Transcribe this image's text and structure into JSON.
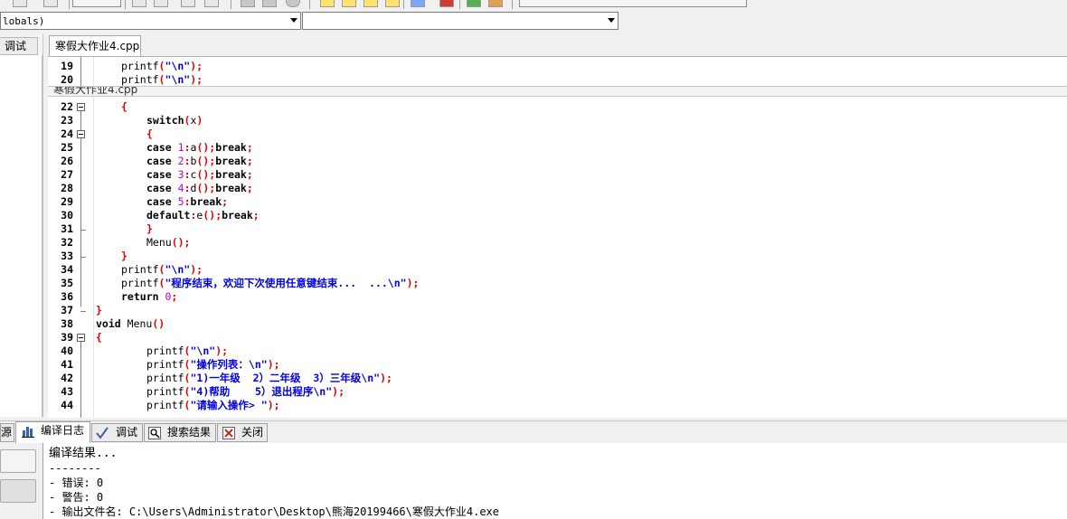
{
  "toolbar": {
    "scope_combo": "lobals)",
    "member_combo": ""
  },
  "left_panel": {
    "tab_debug": "调试"
  },
  "editor": {
    "file_tab": "寒假大作业4.cpp",
    "ghost_tab": "寒假大作业4.cpp",
    "lines": [
      {
        "num": "19",
        "text": "printf(\"\\n\");"
      },
      {
        "num": "20",
        "text": "printf(\"\\n\");"
      },
      {
        "num": "22",
        "text": "{"
      },
      {
        "num": "23",
        "text": "switch(x)"
      },
      {
        "num": "24",
        "text": "{"
      },
      {
        "num": "25",
        "text": "case 1:a();break;"
      },
      {
        "num": "26",
        "text": "case 2:b();break;"
      },
      {
        "num": "27",
        "text": "case 3:c();break;"
      },
      {
        "num": "28",
        "text": "case 4:d();break;"
      },
      {
        "num": "29",
        "text": "case 5:break;"
      },
      {
        "num": "30",
        "text": "default:e();break;"
      },
      {
        "num": "31",
        "text": "}"
      },
      {
        "num": "32",
        "text": "Menu();"
      },
      {
        "num": "33",
        "text": "}"
      },
      {
        "num": "34",
        "text": "printf(\"\\n\");"
      },
      {
        "num": "35",
        "text": "printf(\"程序结束，欢迎下次使用任意键结束...  ...\\n\");"
      },
      {
        "num": "36",
        "text": "return 0;"
      },
      {
        "num": "37",
        "text": "}"
      },
      {
        "num": "38",
        "text": "void Menu()"
      },
      {
        "num": "39",
        "text": "{"
      },
      {
        "num": "40",
        "text": "printf(\"\\n\");"
      },
      {
        "num": "41",
        "text": "printf(\"操作列表：\\n\");"
      },
      {
        "num": "42",
        "text": "printf(\"1)一年级  2）二年级  3）三年级\\n\");"
      },
      {
        "num": "43",
        "text": "printf(\"4)帮助    5）退出程序\\n\");"
      },
      {
        "num": "44",
        "text": "printf(\"请输入操作> \");"
      }
    ]
  },
  "bottom_tabs": {
    "source": "源",
    "compile_log": "编译日志",
    "debug": "调试",
    "search_results": "搜索结果",
    "close": "关闭"
  },
  "output": {
    "line1": "编译结果...",
    "line2": "--------",
    "line3": "- 错误: 0",
    "line4": "- 警告: 0",
    "line5": "- 输出文件名: C:\\Users\\Administrator\\Desktop\\熊海20199466\\寒假大作业4.exe"
  },
  "colors": {
    "keyword": "#000000",
    "punct": "#e00000",
    "string": "#0000e0",
    "number": "#c000c0"
  },
  "icons": [
    "chart-icon",
    "check-icon",
    "search-icon",
    "close-icon"
  ]
}
